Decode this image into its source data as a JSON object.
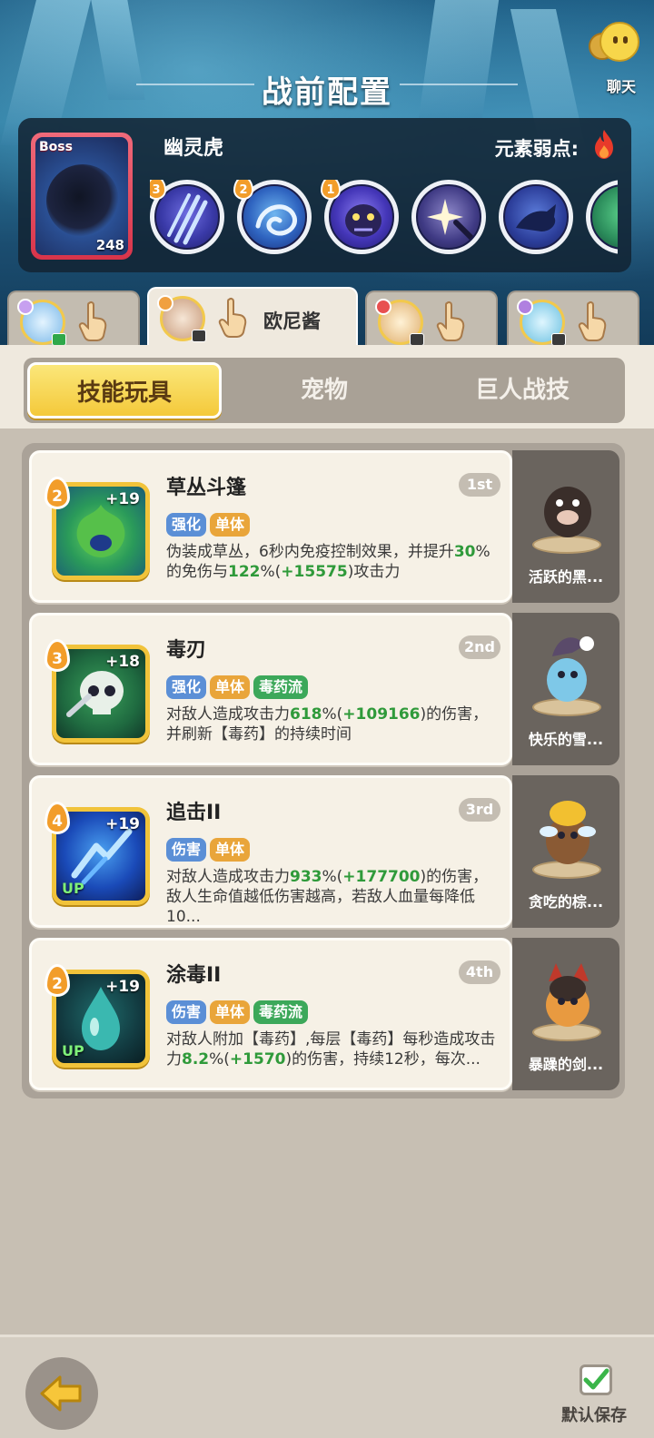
{
  "header": {
    "title": "战前配置",
    "chat_label": "聊天"
  },
  "boss": {
    "tag": "Boss",
    "level": "248",
    "name": "幽灵虎",
    "weakness_label": "元素弱点:",
    "weakness_element": "fire-icon",
    "skills": [
      {
        "level": "3",
        "icon": "claw-slash-icon"
      },
      {
        "level": "2",
        "icon": "spirit-swirl-icon"
      },
      {
        "level": "1",
        "icon": "ghost-tiger-face-icon"
      },
      {
        "level": "",
        "icon": "sparkle-strike-icon"
      },
      {
        "level": "",
        "icon": "pounce-shadow-icon"
      },
      {
        "level": "",
        "icon": "green-orb-icon"
      }
    ]
  },
  "hero_tabs": [
    {
      "name": "",
      "active": false
    },
    {
      "name": "欧尼酱",
      "active": true
    },
    {
      "name": "",
      "active": false
    },
    {
      "name": "",
      "active": false
    }
  ],
  "category_tabs": [
    "技能玩具",
    "宠物",
    "巨人战技"
  ],
  "skills": [
    {
      "name": "草丛斗篷",
      "rank": "1st",
      "level": "2",
      "plus": "+19",
      "up": "",
      "tags": [
        "强化",
        "单体"
      ],
      "desc": [
        "伪装成草丛，6秒内免疫控制效果，并提升",
        "30",
        "%的免伤与",
        "122",
        "%(",
        "+15575",
        ")攻击力"
      ],
      "pet_name": "活跃的黑..."
    },
    {
      "name": "毒刃",
      "rank": "2nd",
      "level": "3",
      "plus": "+18",
      "up": "",
      "tags": [
        "强化",
        "单体",
        "毒药流"
      ],
      "desc": [
        "对敌人造成攻击力",
        "618",
        "%(",
        "+109166",
        ")的伤害，并刷新【毒药】的持续时间"
      ],
      "pet_name": "快乐的雪..."
    },
    {
      "name": "追击II",
      "rank": "3rd",
      "level": "4",
      "plus": "+19",
      "up": "UP",
      "tags": [
        "伤害",
        "单体"
      ],
      "desc": [
        "对敌人造成攻击力",
        "933",
        "%(",
        "+177700",
        ")的伤害，敌人生命值越低伤害越高，若敌人血量每降低10..."
      ],
      "pet_name": "贪吃的棕..."
    },
    {
      "name": "涂毒II",
      "rank": "4th",
      "level": "2",
      "plus": "+19",
      "up": "UP",
      "tags": [
        "伤害",
        "单体",
        "毒药流"
      ],
      "desc": [
        "对敌人附加【毒药】,每层【毒药】每秒造成攻击力",
        "8.2",
        "%(",
        "+1570",
        ")的伤害，持续12秒，每次..."
      ],
      "pet_name": "暴躁的剑..."
    }
  ],
  "footer": {
    "save_label": "默认保存"
  },
  "colors": {
    "accent_yellow": "#f4c93a",
    "highlight_green": "#2f9a3a",
    "tag_blue": "#5b8fd6",
    "tag_orange": "#e9a53a",
    "tag_green": "#3ca85a"
  }
}
